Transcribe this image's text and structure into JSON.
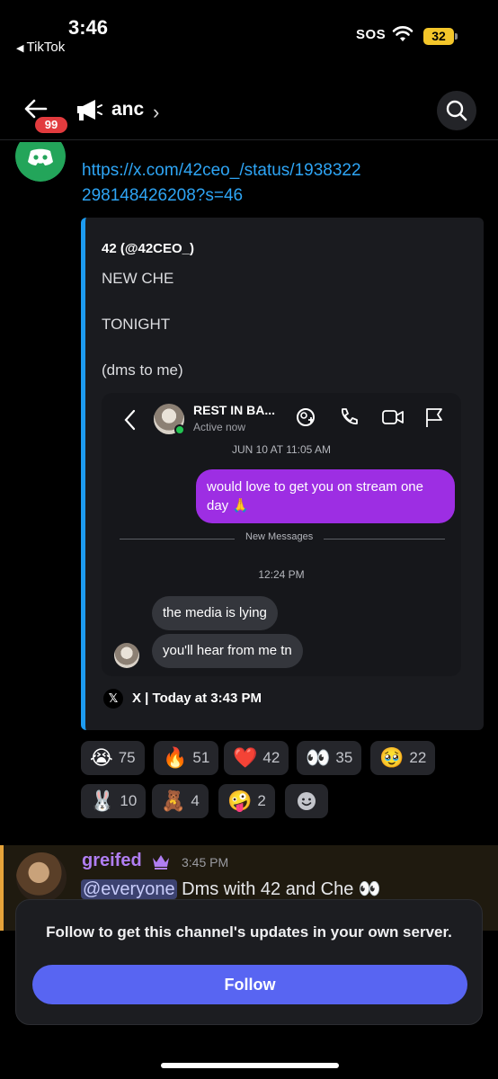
{
  "status_bar": {
    "time": "3:46",
    "back_app": "TikTok",
    "sos": "SOS",
    "battery": "32"
  },
  "header": {
    "badge_count": "99",
    "channel_name": "anc"
  },
  "message1": {
    "link": "https://x.com/42ceo_/status/1938322298148426208?s=46",
    "embed": {
      "author": "42 (@42CEO_)",
      "lines": [
        "NEW CHE",
        "TONIGHT",
        "(dms to me)"
      ],
      "footer": "X | Today at 3:43 PM",
      "screenshot": {
        "contact_name": "REST IN BA...",
        "contact_status": "Active now",
        "date": "JUN 10 AT 11:05 AM",
        "outgoing": "would love to get you on stream one day 🙏",
        "divider_label": "New Messages",
        "time": "12:24 PM",
        "incoming": [
          "the media is lying",
          "you'll hear from me tn"
        ]
      }
    },
    "reactions": [
      {
        "emoji": "😭",
        "count": "75"
      },
      {
        "emoji": "🔥",
        "count": "51"
      },
      {
        "emoji": "❤️",
        "count": "42"
      },
      {
        "emoji": "👀",
        "count": "35"
      },
      {
        "emoji": "🥹",
        "count": "22"
      },
      {
        "emoji": "🐰",
        "count": "10"
      },
      {
        "emoji": "🧸",
        "count": "4"
      },
      {
        "emoji": "🤪",
        "count": "2"
      }
    ]
  },
  "message2": {
    "author": "greifed",
    "time": "3:45 PM",
    "mention": "@everyone",
    "text": " Dms with 42 and Che 👀"
  },
  "follow_card": {
    "text": "Follow to get this channel's updates in your own server.",
    "button": "Follow"
  },
  "colors": {
    "accent": "#5865f2",
    "link": "#2ea5f5",
    "embed_bar": "#1d9bf0",
    "dm_outgoing": "#9d2ee3",
    "badge": "#e23b3e"
  }
}
